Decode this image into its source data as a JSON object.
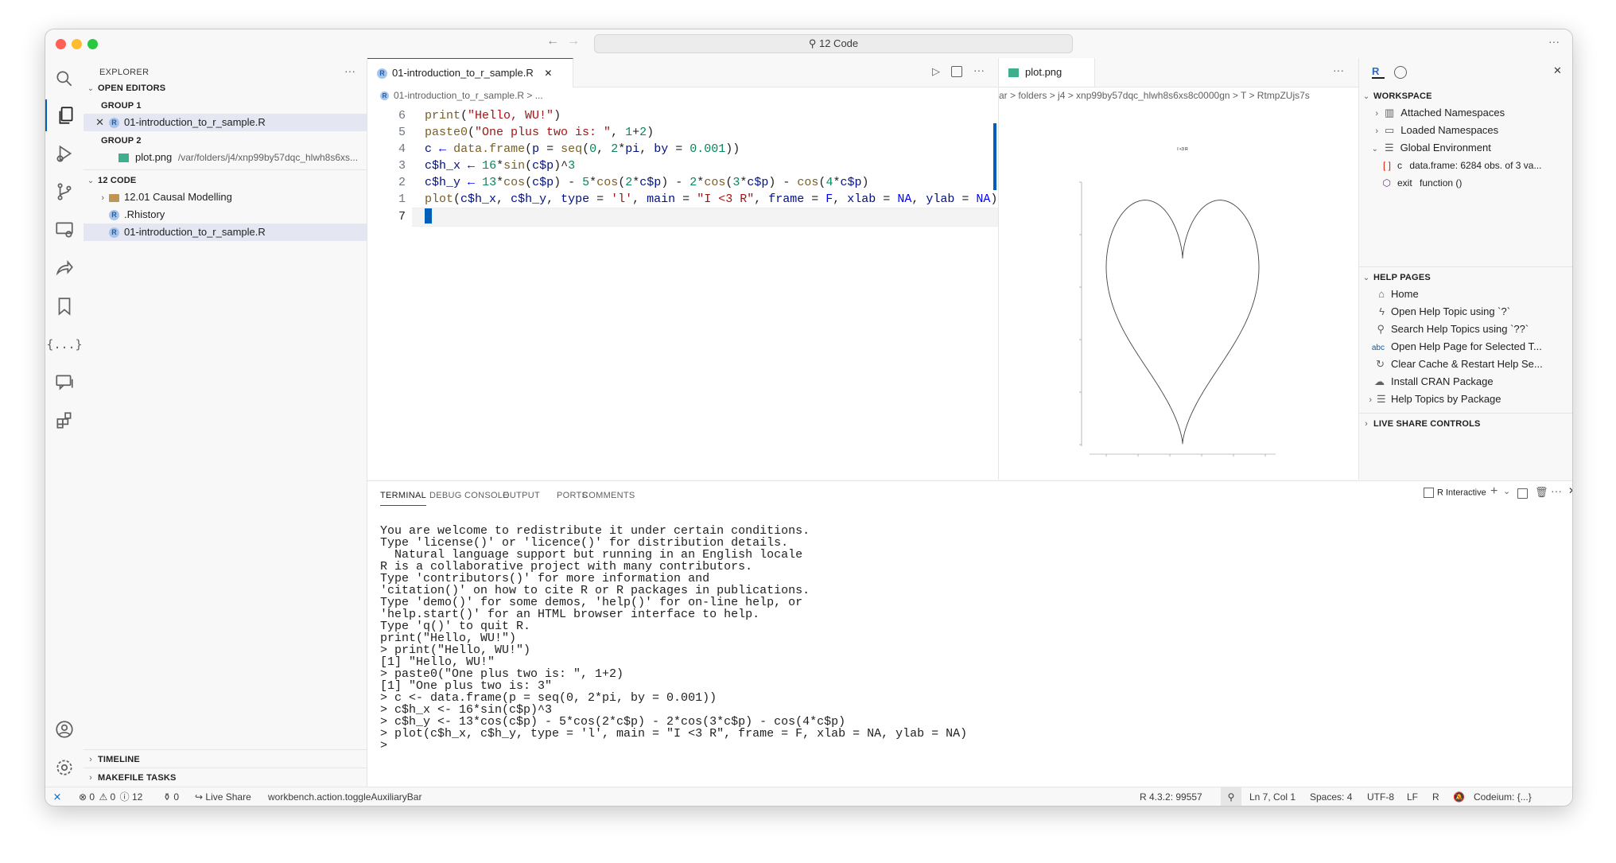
{
  "window": {
    "command_center": "12 Code"
  },
  "explorer": {
    "title": "EXPLORER",
    "open_editors": {
      "label": "OPEN EDITORS",
      "group1": "GROUP 1",
      "group1_file": "01-introduction_to_r_sample.R",
      "group2": "GROUP 2",
      "group2_file": "plot.png",
      "group2_path": "/var/folders/j4/xnp99by57dqc_hlwh8s6xs..."
    },
    "folder": {
      "label": "12 CODE",
      "items": [
        "12.01 Causal Modelling",
        ".Rhistory",
        "01-introduction_to_r_sample.R"
      ]
    },
    "timeline": "TIMELINE",
    "makefile": "MAKEFILE TASKS"
  },
  "editor": {
    "tab": "01-introduction_to_r_sample.R",
    "breadcrumb": "01-introduction_to_r_sample.R > ...",
    "line_numbers": [
      "6",
      "5",
      "4",
      "3",
      "2",
      "1",
      "7"
    ],
    "lines": [
      "print(\"Hello, WU!\")",
      "paste0(\"One plus two is: \", 1+2)",
      "c ← data.frame(p = seq(0, 2*pi, by = 0.001))",
      "c$h_x ← 16*sin(c$p)^3",
      "c$h_y ← 13*cos(c$p) - 5*cos(2*c$p) - 2*cos(3*c$p) - cos(4*c$p)",
      "plot(c$h_x, c$h_y, type = 'l', main = \"I <3 R\", frame = F, xlab = NA, ylab = NA)"
    ]
  },
  "plot_pane": {
    "tab": "plot.png",
    "breadcrumb": "ar > folders > j4 > xnp99by57dqc_hlwh8s6xs8c0000gn > T > RtmpZUjs7s",
    "plot_title": "I <3 R"
  },
  "panel": {
    "tabs": [
      "TERMINAL",
      "DEBUG CONSOLE",
      "OUTPUT",
      "PORTS",
      "COMMENTS"
    ],
    "terminal_name": "R Interactive",
    "terminal_lines": [
      "You are welcome to redistribute it under certain conditions.",
      "Type 'license()' or 'licence()' for distribution details.",
      "",
      "  Natural language support but running in an English locale",
      "",
      "R is a collaborative project with many contributors.",
      "Type 'contributors()' for more information and",
      "'citation()' on how to cite R or R packages in publications.",
      "",
      "Type 'demo()' for some demos, 'help()' for on-line help, or",
      "'help.start()' for an HTML browser interface to help.",
      "Type 'q()' to quit R.",
      "",
      "print(\"Hello, WU!\")",
      "> print(\"Hello, WU!\")",
      "[1] \"Hello, WU!\"",
      "> paste0(\"One plus two is: \", 1+2)",
      "[1] \"One plus two is: 3\"",
      "> c <- data.frame(p = seq(0, 2*pi, by = 0.001))",
      "> c$h_x <- 16*sin(c$p)^3",
      "> c$h_y <- 13*cos(c$p) - 5*cos(2*c$p) - 2*cos(3*c$p) - cos(4*c$p)",
      "> plot(c$h_x, c$h_y, type = 'l', main = \"I <3 R\", frame = F, xlab = NA, ylab = NA)",
      ">"
    ]
  },
  "workspace": {
    "label": "WORKSPACE",
    "items": [
      "Attached Namespaces",
      "Loaded Namespaces",
      "Global Environment"
    ],
    "env_var_name": "c",
    "env_var_value": "data.frame: 6284 obs. of 3 va...",
    "env_fn_name": "exit",
    "env_fn_value": "function ()"
  },
  "help_pages": {
    "label": "HELP PAGES",
    "items": [
      "Home",
      "Open Help Topic using `?`",
      "Search Help Topics using `??`",
      "Open Help Page for Selected T...",
      "Clear Cache & Restart Help Se...",
      "Install CRAN Package",
      "Help Topics by Package"
    ]
  },
  "live_share_controls": "LIVE SHARE CONTROLS",
  "status": {
    "errors": "0",
    "warnings": "0",
    "info": "12",
    "ports": "0",
    "live_share": "Live Share",
    "command": "workbench.action.toggleAuxiliaryBar",
    "r_version": "R 4.3.2: 99557",
    "position": "Ln 7, Col 1",
    "spaces": "Spaces: 4",
    "encoding": "UTF-8",
    "eol": "LF",
    "language": "R",
    "codeium": "Codeium: {...}"
  },
  "colors": {
    "accent": "#005fb8",
    "r_blue": "#276dc3",
    "error_red": "#e51400"
  }
}
